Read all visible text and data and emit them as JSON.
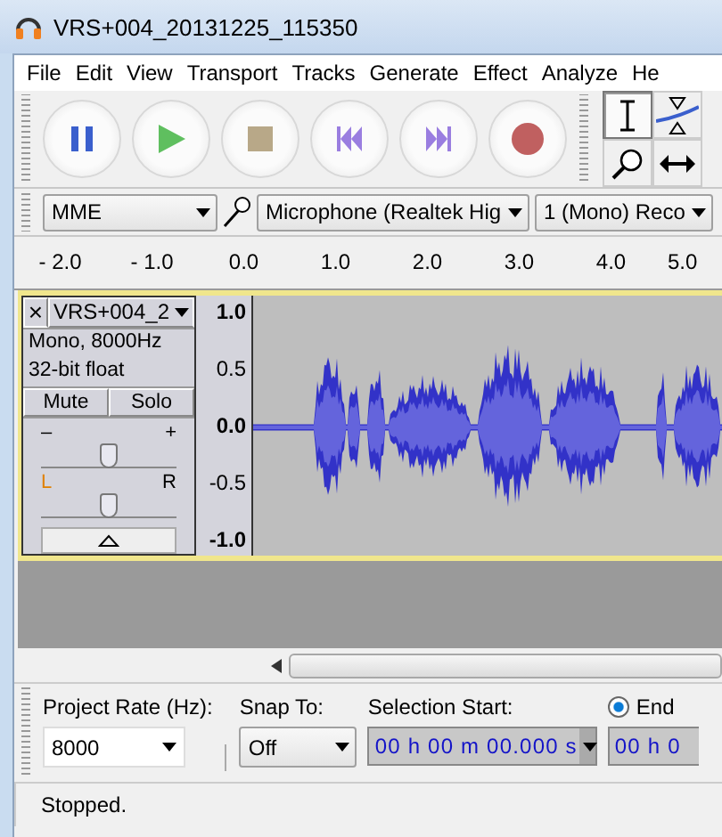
{
  "window": {
    "title": "VRS+004_20131225_115350"
  },
  "menu": [
    "File",
    "Edit",
    "View",
    "Transport",
    "Tracks",
    "Generate",
    "Effect",
    "Analyze",
    "He"
  ],
  "transport_buttons": [
    {
      "kind": "pause"
    },
    {
      "kind": "play"
    },
    {
      "kind": "stop"
    },
    {
      "kind": "skip-start"
    },
    {
      "kind": "skip-end"
    },
    {
      "kind": "record"
    }
  ],
  "tools": [
    {
      "kind": "select",
      "selected": true
    },
    {
      "kind": "envelope",
      "selected": false
    },
    {
      "kind": "zoom",
      "selected": false
    },
    {
      "kind": "timeshift",
      "selected": false
    }
  ],
  "device_toolbar": {
    "host": "MME",
    "input_device": "Microphone (Realtek Hig",
    "channels": "1 (Mono) Reco"
  },
  "ruler": {
    "labels": [
      "- 2.0",
      "- 1.0",
      "0.0",
      "1.0",
      "2.0",
      "3.0",
      "4.0",
      "5.0"
    ]
  },
  "track": {
    "selected": true,
    "close": "×",
    "name": "VRS+004_2",
    "format": "Mono, 8000Hz",
    "sample_format": "32-bit float",
    "mute": {
      "label": "Mute",
      "on": false
    },
    "solo": {
      "label": "Solo",
      "on": false
    },
    "gain": {
      "minus": "–",
      "plus": "+",
      "level": 0.5
    },
    "pan": {
      "left": "L",
      "right": "R",
      "level": 0.5
    },
    "scale": [
      "1.0",
      "0.5",
      "0.0",
      "-0.5",
      "-1.0"
    ]
  },
  "selection_toolbar": {
    "project_rate_label": "Project Rate (Hz):",
    "project_rate": "8000",
    "snap_label": "Snap To:",
    "snap": "Off",
    "start_label": "Selection Start:",
    "start": "00 h 00 m 00.000 s",
    "end_option": {
      "label": "End",
      "selected": true
    },
    "end_value": "00 h 0"
  },
  "status_bar": "Stopped."
}
